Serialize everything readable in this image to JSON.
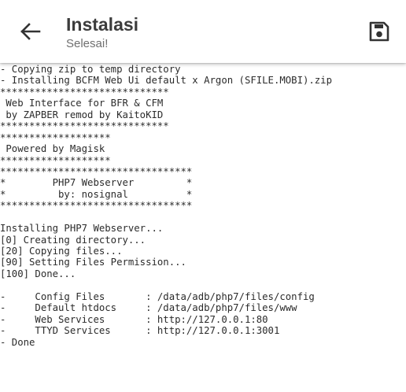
{
  "toolbar": {
    "back_icon": "arrow-left-icon",
    "title": "Instalasi",
    "subtitle": "Selesai!",
    "save_icon": "floppy-disk-icon"
  },
  "log_lines": [
    "- Copying zip to temp directory",
    "- Installing BCFM Web Ui default x Argon (SFILE.MOBI).zip",
    "*****************************",
    " Web Interface for BFR & CFM",
    " by ZAPBER remod by KaitoKID",
    "*****************************",
    "*******************",
    " Powered by Magisk",
    "*******************",
    "*********************************",
    "*        PHP7 Webserver         *",
    "*         by: nosignal          *",
    "*********************************",
    "",
    "Installing PHP7 Webserver...",
    "[0] Creating directory...",
    "[20] Copying files...",
    "[90] Setting Files Permission...",
    "[100] Done...",
    "",
    "-     Config Files       : /data/adb/php7/files/config",
    "-     Default htdocs     : /data/adb/php7/files/www",
    "-     Web Services       : http://127.0.0.1:80",
    "-     TTYD Services      : http://127.0.0.1:3001",
    "- Done"
  ]
}
